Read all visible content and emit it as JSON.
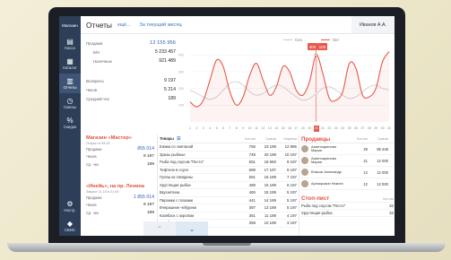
{
  "sidebar": {
    "header": "Магазин",
    "items": [
      {
        "label": "Касса",
        "icon": "register-icon"
      },
      {
        "label": "Каталог",
        "icon": "catalog-icon"
      },
      {
        "label": "Отчеты",
        "icon": "reports-icon",
        "active": true
      },
      {
        "label": "Смены",
        "icon": "clock-icon"
      },
      {
        "label": "Скидки",
        "icon": "discount-icon"
      }
    ],
    "bottom": [
      {
        "label": "Настр.",
        "icon": "gear-icon"
      },
      {
        "label": "СБИС",
        "icon": "sbis-icon"
      }
    ]
  },
  "header": {
    "title": "Отчеты",
    "more": "ещё...",
    "period": "За текущий месяц",
    "user": "Иванов А.А."
  },
  "stats": {
    "sales_label": "Продажи",
    "sales_value": "12 155 956",
    "bn_label": "Б/Н",
    "bn_value": "5 233 457",
    "cash_label": "Наличные",
    "cash_value": "921 489",
    "returns_label": "Возвраты",
    "returns_value": "9 197",
    "checks_label": "Чеков",
    "checks_value": "5 214",
    "avg_label": "Средний чек",
    "avg_value": "189"
  },
  "chart_data": {
    "type": "line",
    "legend": [
      "Сен",
      "Окт"
    ],
    "colors": {
      "Сен": "#c9c9c9",
      "Окт": "#e8584b"
    },
    "y_ticks": [
      "400",
      "300",
      "200",
      "100"
    ],
    "ylim": [
      0,
      450
    ],
    "x": [
      1,
      2,
      3,
      4,
      5,
      6,
      7,
      8,
      9,
      10,
      11,
      12,
      13,
      14,
      15,
      16,
      17,
      18,
      19,
      20,
      21,
      22,
      23,
      24,
      25,
      26,
      27,
      28,
      29,
      30,
      31
    ],
    "series": [
      {
        "name": "Сен",
        "values": [
          190,
          170,
          150,
          135,
          150,
          190,
          230,
          240,
          220,
          180,
          160,
          170,
          200,
          220,
          210,
          180,
          150,
          130,
          140,
          170,
          200,
          210,
          190,
          160,
          140,
          150,
          180,
          210,
          220,
          200,
          190
        ]
      },
      {
        "name": "Окт",
        "values": [
          120,
          90,
          130,
          250,
          370,
          330,
          180,
          100,
          150,
          280,
          350,
          250,
          160,
          210,
          330,
          300,
          190,
          160,
          240,
          400,
          290,
          140,
          130,
          180,
          350,
          320,
          160,
          150,
          200,
          360,
          420
        ]
      }
    ],
    "highlight": {
      "x": 20,
      "values": [
        "400",
        "100"
      ]
    },
    "active_day": "20"
  },
  "shops": [
    {
      "name": "Магазин «Мастер»",
      "status": "Открыт в 09:00",
      "rows": [
        {
          "label": "Продажи",
          "value": "855 014"
        },
        {
          "label": "Чеков",
          "value": "9 197"
        },
        {
          "label": "Ср. чек",
          "value": "189"
        }
      ]
    },
    {
      "name": "«Инейь», на пр. Ленина",
      "status": "Закрыт 11.10 в 21:00",
      "rows": [
        {
          "label": "Продажи",
          "value": "1 855 014"
        },
        {
          "label": "Чеков",
          "value": "9 197"
        },
        {
          "label": "Ср. чек",
          "value": "189"
        }
      ]
    }
  ],
  "goods": {
    "title": "Товары",
    "columns": [
      "Кол-во",
      "Сумма",
      "Наценка"
    ],
    "rows": [
      {
        "name": "Ежики со сметаной",
        "qty": "756",
        "sum": "23 189",
        "markup": "12 985"
      },
      {
        "name": "Зразы рыбные",
        "qty": "749",
        "sum": "20 189",
        "markup": "10 197"
      },
      {
        "name": "Рыба под соусом \"Песто\"",
        "qty": "651",
        "sum": "18 560",
        "markup": "9 197"
      },
      {
        "name": "Тефтели в соусе",
        "qty": "598",
        "sum": "17 197",
        "markup": "9 197"
      },
      {
        "name": "Гуляш из говядины",
        "qty": "591",
        "sum": "16 189",
        "markup": "7 197"
      },
      {
        "name": "Хрустящая рыбка",
        "qty": "489",
        "sum": "15 189",
        "markup": "6 197"
      },
      {
        "name": "Вкуснятина",
        "qty": "465",
        "sum": "15 189",
        "markup": "5 197"
      },
      {
        "name": "Пирожки с глазами",
        "qty": "441",
        "sum": "14 189",
        "markup": "5 197"
      },
      {
        "name": "Вчерашние чебуреки",
        "qty": "397",
        "sum": "13 189",
        "markup": "5 197"
      },
      {
        "name": "Казябзох с окропом",
        "qty": "361",
        "sum": "11 189",
        "markup": "4 197"
      },
      {
        "name": "Голубцы в непроходим...",
        "qty": "358",
        "sum": "10 189",
        "markup": "3 197"
      }
    ]
  },
  "sellers": {
    "title": "Продавцы",
    "columns": [
      "Кол-во",
      "Сумма"
    ],
    "rows": [
      {
        "name": "Ахметзарипова Мария",
        "qty": "29",
        "sum": "96 448"
      },
      {
        "name": "Ахметзарипова Мария",
        "qty": "21",
        "sum": "12 000"
      },
      {
        "name": "Власов Александр",
        "qty": "12",
        "sum": "12 000"
      },
      {
        "name": "Архикушкин Никита",
        "qty": "12",
        "sum": "12 000"
      }
    ]
  },
  "stoplist": {
    "title": "Стоп-лист",
    "column": "Кол-во",
    "rows": [
      {
        "name": "Рыба под соусом \"Песто\"",
        "value": "32"
      },
      {
        "name": "Хрустящая рыбка",
        "value": "32"
      }
    ]
  }
}
